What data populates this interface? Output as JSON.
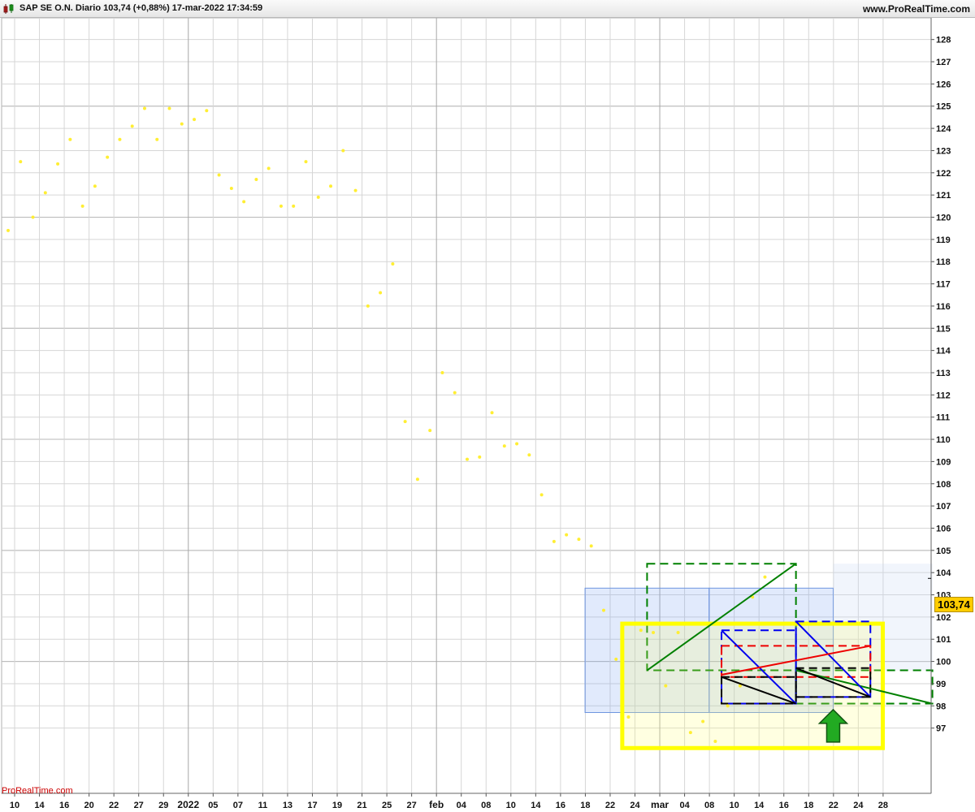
{
  "header": {
    "title": "SAP SE O.N. Diario 103,74 (+0,88%) 17-mar-2022 17:34:59",
    "brand": "www.ProRealTime.com"
  },
  "watermark": "ProRealTime.com",
  "last_price_label": "103,74",
  "colors": {
    "dots": "#ffee33",
    "grid": "#d6d6d6",
    "highlight": "#ffff00",
    "green": "#008000",
    "blue": "#0000ee",
    "red": "#ee0000",
    "arrow": "#22aa22",
    "badge": "#ffcc00"
  },
  "icons": {
    "title_icon": "candlestick-icon",
    "signal_icon": "arrow-up-icon"
  },
  "chart_data": {
    "type": "scatter",
    "ylim": [
      96,
      128.5
    ],
    "y_ticks": [
      97,
      98,
      99,
      100,
      101,
      102,
      103,
      104,
      105,
      106,
      107,
      108,
      109,
      110,
      111,
      112,
      113,
      114,
      115,
      116,
      117,
      118,
      119,
      120,
      121,
      122,
      123,
      124,
      125,
      126,
      127,
      128
    ],
    "x_labels": [
      "10",
      "14",
      "16",
      "20",
      "22",
      "27",
      "29",
      "2022",
      "05",
      "07",
      "11",
      "13",
      "17",
      "19",
      "21",
      "25",
      "27",
      "feb",
      "04",
      "08",
      "10",
      "14",
      "16",
      "18",
      "22",
      "24",
      "mar",
      "04",
      "08",
      "10",
      "14",
      "16",
      "18",
      "22",
      "24",
      "28"
    ],
    "x_label_bold": [
      "2022",
      "feb",
      "mar"
    ],
    "grid": true,
    "series": [
      {
        "values": [
          119.4,
          122.5,
          120.0,
          121.1,
          122.4,
          123.5,
          120.5,
          121.4,
          122.7,
          123.5,
          124.1,
          124.9,
          123.5,
          124.9,
          124.2,
          124.4,
          124.8,
          121.9,
          121.3,
          120.7,
          121.7,
          122.2,
          120.5,
          120.5,
          122.5,
          120.9,
          121.4,
          123.0,
          121.2,
          116.0,
          116.6,
          117.9,
          110.8,
          108.2,
          110.4,
          113.0,
          112.1,
          109.1,
          109.2,
          111.2,
          109.7,
          109.8,
          109.3,
          107.5,
          105.4,
          105.7,
          105.5,
          105.2,
          102.3,
          100.1,
          97.5,
          101.4,
          101.3,
          98.9,
          101.3,
          96.8,
          97.3,
          96.4,
          98.0,
          98.9,
          102.9,
          103.8
        ]
      }
    ],
    "last_value": 103.74,
    "annotations": [
      {
        "type": "rect",
        "style": "filled-blue",
        "x0": 46.5,
        "x1": 56.5,
        "y0": 97.7,
        "y1": 103.3
      },
      {
        "type": "rect",
        "style": "filled-blue",
        "x0": 56.5,
        "x1": 66.5,
        "y0": 97.7,
        "y1": 103.3
      },
      {
        "type": "rect",
        "style": "filled-light",
        "x0": 66.5,
        "x1": 74.5,
        "y0": 99.6,
        "y1": 104.4
      },
      {
        "type": "rect",
        "style": "dashed-green",
        "x0": 51.5,
        "x1": 63.5,
        "y0": 99.6,
        "y1": 104.4
      },
      {
        "type": "rect",
        "style": "dashed-green",
        "x0": 63.5,
        "x1": 74.5,
        "y0": 98.1,
        "y1": 99.6
      },
      {
        "type": "rect",
        "style": "highlight-yellow",
        "x0": 49.5,
        "x1": 70.5,
        "y0": 96.1,
        "y1": 101.7
      },
      {
        "type": "line",
        "color": "green",
        "x0": 51.5,
        "y0": 99.6,
        "x1": 63.5,
        "y1": 104.4
      },
      {
        "type": "line",
        "color": "green",
        "x0": 63.5,
        "y0": 99.6,
        "x1": 74.5,
        "y1": 98.1
      },
      {
        "type": "rect",
        "style": "dashed-blue",
        "x0": 57.5,
        "x1": 63.5,
        "y0": 98.1,
        "y1": 101.4
      },
      {
        "type": "rect",
        "style": "dashed-blue",
        "x0": 63.5,
        "x1": 69.5,
        "y0": 98.4,
        "y1": 101.8
      },
      {
        "type": "line",
        "color": "blue",
        "x0": 57.5,
        "y0": 101.4,
        "x1": 63.5,
        "y1": 98.1
      },
      {
        "type": "line",
        "color": "blue",
        "x0": 63.5,
        "y0": 101.8,
        "x1": 69.5,
        "y1": 98.4
      },
      {
        "type": "rect",
        "style": "dashed-red",
        "x0": 57.5,
        "x1": 69.5,
        "y0": 99.3,
        "y1": 100.7
      },
      {
        "type": "line",
        "color": "red",
        "x0": 57.5,
        "y0": 99.4,
        "x1": 69.5,
        "y1": 100.7
      },
      {
        "type": "rect",
        "style": "dashed-black",
        "x0": 57.5,
        "x1": 63.5,
        "y0": 98.1,
        "y1": 99.3
      },
      {
        "type": "rect",
        "style": "dashed-black",
        "x0": 63.5,
        "x1": 69.5,
        "y0": 98.4,
        "y1": 99.7
      },
      {
        "type": "line",
        "color": "black",
        "x0": 57.5,
        "y0": 99.3,
        "x1": 63.5,
        "y1": 98.1
      },
      {
        "type": "line",
        "color": "black",
        "x0": 63.5,
        "y0": 99.7,
        "x1": 69.5,
        "y1": 98.4
      }
    ],
    "signal": {
      "type": "arrow-up",
      "x": 66.5,
      "y": 97.1
    }
  }
}
